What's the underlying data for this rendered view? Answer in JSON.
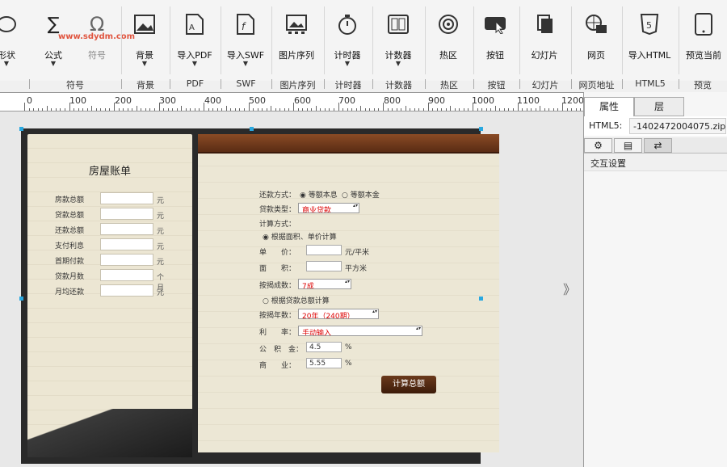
{
  "toolbar": {
    "tools": [
      {
        "label": "形状",
        "icon": "shape-icon"
      },
      {
        "label": "公式",
        "icon": "formula-icon"
      },
      {
        "label": "符号",
        "icon": "symbol-icon"
      },
      {
        "label": "背景",
        "icon": "background-icon"
      },
      {
        "label": "导入PDF",
        "icon": "pdf-icon"
      },
      {
        "label": "导入SWF",
        "icon": "swf-icon"
      },
      {
        "label": "图片序列",
        "icon": "image-sequence-icon"
      },
      {
        "label": "计时器",
        "icon": "stopwatch-icon"
      },
      {
        "label": "计数器",
        "icon": "counter-icon"
      },
      {
        "label": "热区",
        "icon": "hotspot-icon"
      },
      {
        "label": "按钮",
        "icon": "button-icon"
      },
      {
        "label": "幻灯片",
        "icon": "slideshow-icon"
      },
      {
        "label": "网页",
        "icon": "webpage-icon"
      },
      {
        "label": "导入HTML",
        "icon": "html5-icon"
      },
      {
        "label": "预览当前",
        "icon": "tablet-icon"
      }
    ],
    "groups": [
      "符号",
      "背景",
      "PDF",
      "SWF",
      "图片序列",
      "计时器",
      "计数器",
      "热区",
      "按钮",
      "幻灯片",
      "网页地址",
      "HTML5",
      "预览"
    ],
    "watermark": "www.sdydm.com"
  },
  "ruler": {
    "ticks": [
      "0",
      "100",
      "200",
      "300",
      "400",
      "500",
      "600",
      "700",
      "800",
      "900",
      "1000",
      "1100",
      "1200"
    ]
  },
  "bill": {
    "title": "房屋账单",
    "rows": [
      {
        "label": "房款总额",
        "unit": "元"
      },
      {
        "label": "贷款总额",
        "unit": "元"
      },
      {
        "label": "还款总额",
        "unit": "元"
      },
      {
        "label": "支付利息",
        "unit": "元"
      },
      {
        "label": "首期付款",
        "unit": "元"
      },
      {
        "label": "贷款月数",
        "unit": "个月"
      },
      {
        "label": "月均还款",
        "unit": "元"
      }
    ]
  },
  "calc": {
    "repay_method_label": "还款方式：",
    "repay_opt1": "等额本息",
    "repay_opt2": "等额本金",
    "loan_type_label": "贷款类型：",
    "loan_type_value": "商业贷款",
    "calc_method_label": "计算方式：",
    "calc_opt1": "根据面积、单价计算",
    "unit_price_label": "单　　价：",
    "unit_price_unit": "元/平米",
    "area_label": "面　　积：",
    "area_unit": "平方米",
    "mortgage_label": "按揭成数：",
    "mortgage_value": "7成",
    "calc_opt2": "根据贷款总额计算",
    "years_label": "按揭年数：",
    "years_value": "20年（240期）",
    "rate_label": "利　　率：",
    "rate_value": "手动输入",
    "provident_label": "公　积　金：",
    "provident_value": "4.5",
    "commercial_label": "商　　业：",
    "commercial_value": "5.55",
    "percent": "%",
    "submit": "计算总额"
  },
  "panel": {
    "tab1": "属性",
    "tab2": "层",
    "html5_key": "HTML5:",
    "html5_value": "-1402472004075.zip",
    "section": "交互设置"
  }
}
